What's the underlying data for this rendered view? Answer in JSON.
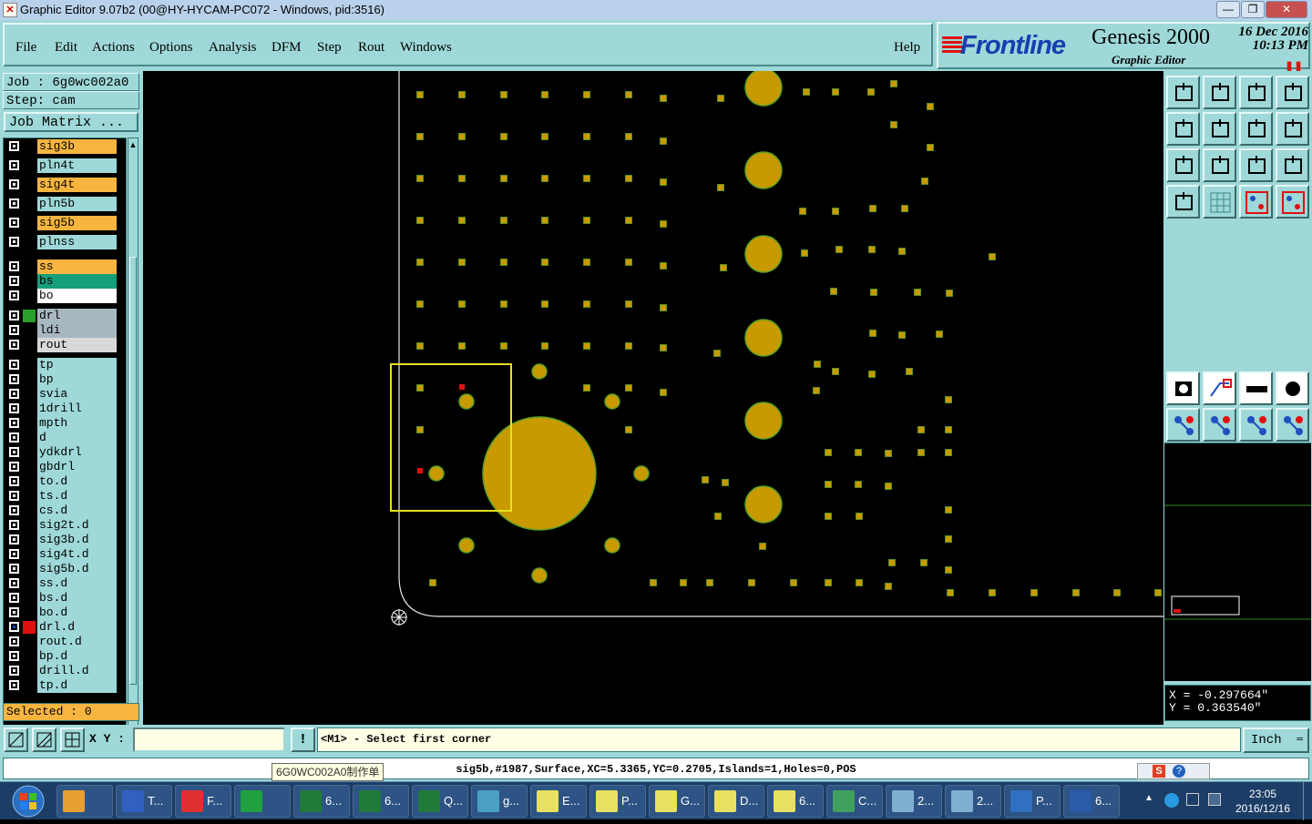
{
  "window": {
    "title": "Graphic Editor 9.07b2 (00@HY-HYCAM-PC072 - Windows, pid:3516)",
    "minimize": "—",
    "restore": "❐",
    "close": "✕"
  },
  "menu": {
    "items": [
      "File",
      "Edit",
      "Actions",
      "Options",
      "Analysis",
      "DFM",
      "Step",
      "Rout",
      "Windows"
    ],
    "help": "Help"
  },
  "branding": {
    "company": "Frontline",
    "product": "Genesis 2000",
    "subtitle": "Graphic Editor",
    "date": "16 Dec 2016",
    "time": "10:13 PM",
    "pause_icon": "pause-icon"
  },
  "job": {
    "job_label": "Job : 6g0wc002a0",
    "step_label": "Step: cam",
    "job_matrix": "Job Matrix ...",
    "selected": "Selected : 0"
  },
  "layers": [
    {
      "name": "sig3b",
      "color": "#f7b540",
      "swatch": ""
    },
    {
      "name": "pln4t",
      "color": "#9fd8d8",
      "swatch": ""
    },
    {
      "name": "sig4t",
      "color": "#f7b540",
      "swatch": ""
    },
    {
      "name": "pln5b",
      "color": "#9fd8d8",
      "swatch": ""
    },
    {
      "name": "sig5b",
      "color": "#f7b540",
      "swatch": ""
    },
    {
      "name": "plnss",
      "color": "#9fd8d8",
      "swatch": ""
    },
    {
      "name": "ss",
      "color": "#f7b540",
      "swatch": ""
    },
    {
      "name": "bs",
      "color": "#14a07a",
      "swatch": ""
    },
    {
      "name": "bo",
      "color": "#ffffff",
      "swatch": ""
    },
    {
      "name": "drl",
      "color": "#a8b8c0",
      "swatch": "#2aa02a"
    },
    {
      "name": "ldi",
      "color": "#a8b8c0",
      "swatch": ""
    },
    {
      "name": "rout",
      "color": "#d8d8d8",
      "swatch": ""
    },
    {
      "name": "tp",
      "color": "#9fd8d8",
      "swatch": ""
    },
    {
      "name": "bp",
      "color": "#9fd8d8",
      "swatch": ""
    },
    {
      "name": "svia",
      "color": "#9fd8d8",
      "swatch": ""
    },
    {
      "name": "1drill",
      "color": "#9fd8d8",
      "swatch": ""
    },
    {
      "name": "mpth",
      "color": "#9fd8d8",
      "swatch": ""
    },
    {
      "name": "d",
      "color": "#9fd8d8",
      "swatch": ""
    },
    {
      "name": "ydkdrl",
      "color": "#9fd8d8",
      "swatch": ""
    },
    {
      "name": "gbdrl",
      "color": "#9fd8d8",
      "swatch": ""
    },
    {
      "name": "to.d",
      "color": "#9fd8d8",
      "swatch": ""
    },
    {
      "name": "ts.d",
      "color": "#9fd8d8",
      "swatch": ""
    },
    {
      "name": "cs.d",
      "color": "#9fd8d8",
      "swatch": ""
    },
    {
      "name": "sig2t.d",
      "color": "#9fd8d8",
      "swatch": ""
    },
    {
      "name": "sig3b.d",
      "color": "#9fd8d8",
      "swatch": ""
    },
    {
      "name": "sig4t.d",
      "color": "#9fd8d8",
      "swatch": ""
    },
    {
      "name": "sig5b.d",
      "color": "#9fd8d8",
      "swatch": ""
    },
    {
      "name": "ss.d",
      "color": "#9fd8d8",
      "swatch": ""
    },
    {
      "name": "bs.d",
      "color": "#9fd8d8",
      "swatch": ""
    },
    {
      "name": "bo.d",
      "color": "#9fd8d8",
      "swatch": ""
    },
    {
      "name": "drl.d",
      "color": "#9fd8d8",
      "swatch": "#e01010"
    },
    {
      "name": "rout.d",
      "color": "#9fd8d8",
      "swatch": ""
    },
    {
      "name": "bp.d",
      "color": "#9fd8d8",
      "swatch": ""
    },
    {
      "name": "drill.d",
      "color": "#9fd8d8",
      "swatch": ""
    },
    {
      "name": "tp.d",
      "color": "#9fd8d8",
      "swatch": ""
    }
  ],
  "cursor": {
    "x": "X = -0.297664\"",
    "y": "Y =  0.363540\""
  },
  "command": {
    "xy_label": "X Y :",
    "xy_value": "",
    "prompt": "<M1> - Select first corner",
    "units": "Inch"
  },
  "status": {
    "feature_info": "sig5b,#1987,Surface,XC=5.3365,YC=0.2705,Islands=1,Holes=0,POS",
    "tooltip": "6G0WC002A0制作单"
  },
  "taskbar": {
    "items": [
      {
        "label": "",
        "color": "#e8a030"
      },
      {
        "label": "T...",
        "color": "#3060c0"
      },
      {
        "label": "F...",
        "color": "#e03030"
      },
      {
        "label": "",
        "color": "#20a040"
      },
      {
        "label": "6...",
        "color": "#1f7a3a"
      },
      {
        "label": "6...",
        "color": "#1f7a3a"
      },
      {
        "label": "Q...",
        "color": "#1f7a3a"
      },
      {
        "label": "g...",
        "color": "#4aa0c0"
      },
      {
        "label": "E...",
        "color": "#e8e060"
      },
      {
        "label": "P...",
        "color": "#e8e060"
      },
      {
        "label": "G...",
        "color": "#e8e060"
      },
      {
        "label": "D...",
        "color": "#e8e060"
      },
      {
        "label": "6...",
        "color": "#e8e060"
      },
      {
        "label": "C...",
        "color": "#40a060"
      },
      {
        "label": "2...",
        "color": "#80b0d0"
      },
      {
        "label": "2...",
        "color": "#80b0d0"
      },
      {
        "label": "P...",
        "color": "#3070c0"
      },
      {
        "label": "6...",
        "color": "#2a5aaa"
      }
    ],
    "clock_time": "23:05",
    "clock_date": "2016/12/16"
  },
  "colors": {
    "panel": "#9fd8d8",
    "pad": "#c89a00",
    "pad_outline": "#5aa02a",
    "selection_box": "#e8e020"
  }
}
